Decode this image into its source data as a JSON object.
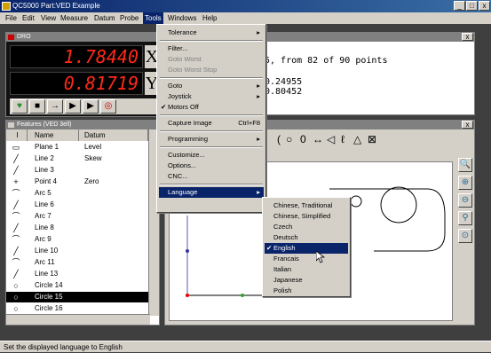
{
  "app": {
    "title": "QC5000 Part:VED Example",
    "min": "_",
    "max": "□",
    "close": "x"
  },
  "menubar": [
    "File",
    "Edit",
    "View",
    "Measure",
    "Datum",
    "Probe",
    "Tools",
    "Windows",
    "Help"
  ],
  "dro": {
    "title": "DRO",
    "x_value": "1.78440",
    "x_axis": "X",
    "y_value": "0.81719",
    "y_axis": "Y",
    "tools": [
      "♥",
      "■",
      "→",
      "▶",
      "▶",
      "◎"
    ]
  },
  "output": {
    "close": "x",
    "lines": [
      "5, from 82 of 90 points",
      "0.24955",
      "0.80452"
    ]
  },
  "features": {
    "title": "Features (VED 3ell)",
    "columns": [
      "I",
      "Name",
      "Datum"
    ],
    "rows": [
      {
        "icon": "▭",
        "name": "Plane 1",
        "datum": "Level"
      },
      {
        "icon": "╱",
        "name": "Line 2",
        "datum": "Skew"
      },
      {
        "icon": "╱",
        "name": "Line 3",
        "datum": ""
      },
      {
        "icon": "+",
        "name": "Point 4",
        "datum": "Zero"
      },
      {
        "icon": "⌒",
        "name": "Arc 5",
        "datum": ""
      },
      {
        "icon": "╱",
        "name": "Line 6",
        "datum": ""
      },
      {
        "icon": "⌒",
        "name": "Arc 7",
        "datum": ""
      },
      {
        "icon": "╱",
        "name": "Line 8",
        "datum": ""
      },
      {
        "icon": "⌒",
        "name": "Arc 9",
        "datum": ""
      },
      {
        "icon": "╱",
        "name": "Line 10",
        "datum": ""
      },
      {
        "icon": "⌒",
        "name": "Arc 11",
        "datum": ""
      },
      {
        "icon": "╱",
        "name": "Line 13",
        "datum": ""
      },
      {
        "icon": "○",
        "name": "Circle 14",
        "datum": ""
      },
      {
        "icon": "○",
        "name": "Circle 15",
        "datum": ""
      },
      {
        "icon": "○",
        "name": "Circle 16",
        "datum": ""
      }
    ],
    "selected_index": 13
  },
  "graphics": {
    "close": "x",
    "toolbar": [
      "(",
      "○",
      "0",
      "↔",
      "◁",
      "ℓ",
      "△",
      "⊠"
    ],
    "zoom": [
      "🔍",
      "⊕",
      "⊖",
      "⚲",
      "⊙"
    ]
  },
  "tools_menu": {
    "items": [
      {
        "label": "Tolerance",
        "submenu": true
      },
      {
        "sep": true
      },
      {
        "label": "Filter..."
      },
      {
        "label": "Goto Worst",
        "disabled": true
      },
      {
        "label": "Goto Worst Stop",
        "disabled": true
      },
      {
        "sep": true
      },
      {
        "label": "Goto",
        "submenu": true
      },
      {
        "label": "Joystick",
        "submenu": true
      },
      {
        "label": "Motors Off",
        "checked": true
      },
      {
        "sep": true
      },
      {
        "label": "Capture Image",
        "shortcut": "Ctrl+F8"
      },
      {
        "sep": true
      },
      {
        "label": "Programming",
        "submenu": true
      },
      {
        "sep": true
      },
      {
        "label": "Customize..."
      },
      {
        "label": "Options..."
      },
      {
        "label": "CNC..."
      },
      {
        "sep": true
      },
      {
        "label": "Language",
        "submenu": true,
        "highlighted": true
      }
    ]
  },
  "language_menu": {
    "items": [
      {
        "label": "Chinese, Traditional"
      },
      {
        "label": "Chinese, Simplified"
      },
      {
        "label": "Czech"
      },
      {
        "label": "Deutsch"
      },
      {
        "label": "English",
        "checked": true,
        "highlighted": true
      },
      {
        "label": "Francais"
      },
      {
        "label": "Italian"
      },
      {
        "label": "Japanese"
      },
      {
        "label": "Polish"
      }
    ]
  },
  "status": "Set the displayed language to English"
}
